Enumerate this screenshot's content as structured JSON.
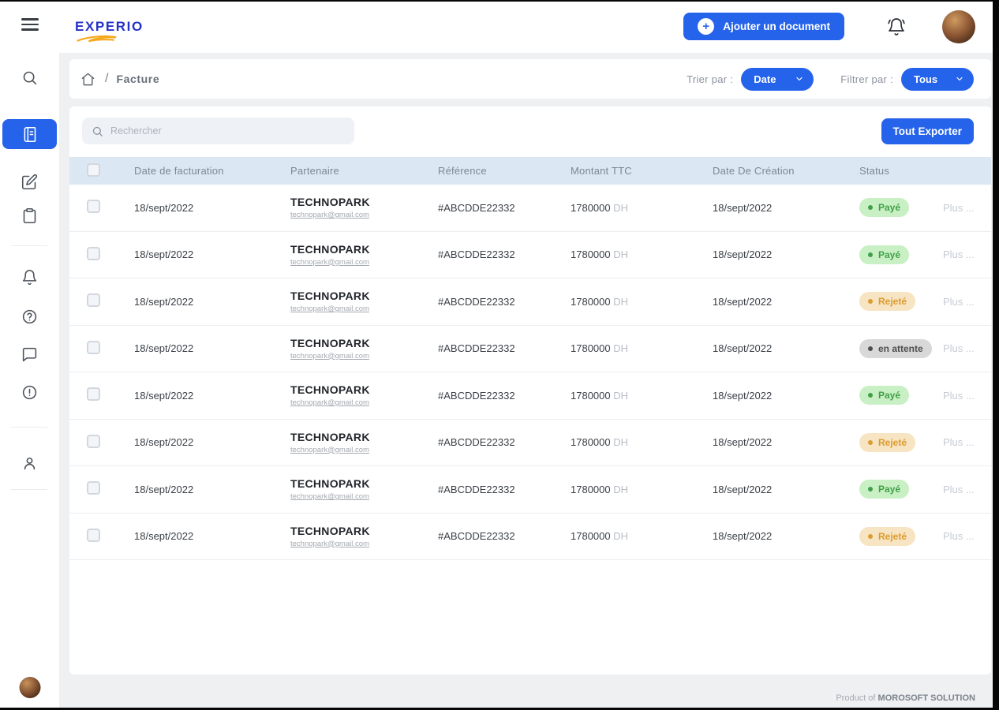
{
  "brand": {
    "name": "EXPERIO"
  },
  "header": {
    "add_document_button": "Ajouter un document"
  },
  "breadcrumb": {
    "separator": "/",
    "current": "Facture"
  },
  "filters": {
    "sort_label": "Trier par :",
    "sort_value": "Date",
    "filter_label": "Filtrer par :",
    "filter_value": "Tous"
  },
  "toolbar": {
    "search_placeholder": "Rechercher",
    "export_button": "Tout Exporter"
  },
  "table": {
    "columns": [
      "Date de facturation",
      "Partenaire",
      "Référence",
      "Montant TTC",
      "Date De Création",
      "Status"
    ],
    "more_label": "Plus ...",
    "rows": [
      {
        "date": "18/sept/2022",
        "partner": "TECHNOPARK",
        "email": "technopark@gmail.com",
        "reference": "#ABCDDE22332",
        "amount": "1780000",
        "currency": "DH",
        "created": "18/sept/2022",
        "status": "Payé",
        "status_type": "paid"
      },
      {
        "date": "18/sept/2022",
        "partner": "TECHNOPARK",
        "email": "technopark@gmail.com",
        "reference": "#ABCDDE22332",
        "amount": "1780000",
        "currency": "DH",
        "created": "18/sept/2022",
        "status": "Payé",
        "status_type": "paid"
      },
      {
        "date": "18/sept/2022",
        "partner": "TECHNOPARK",
        "email": "technopark@gmail.com",
        "reference": "#ABCDDE22332",
        "amount": "1780000",
        "currency": "DH",
        "created": "18/sept/2022",
        "status": "Rejeté",
        "status_type": "rejected"
      },
      {
        "date": "18/sept/2022",
        "partner": "TECHNOPARK",
        "email": "technopark@gmail.com",
        "reference": "#ABCDDE22332",
        "amount": "1780000",
        "currency": "DH",
        "created": "18/sept/2022",
        "status": "en attente",
        "status_type": "pending"
      },
      {
        "date": "18/sept/2022",
        "partner": "TECHNOPARK",
        "email": "technopark@gmail.com",
        "reference": "#ABCDDE22332",
        "amount": "1780000",
        "currency": "DH",
        "created": "18/sept/2022",
        "status": "Payé",
        "status_type": "paid"
      },
      {
        "date": "18/sept/2022",
        "partner": "TECHNOPARK",
        "email": "technopark@gmail.com",
        "reference": "#ABCDDE22332",
        "amount": "1780000",
        "currency": "DH",
        "created": "18/sept/2022",
        "status": "Rejeté",
        "status_type": "rejected"
      },
      {
        "date": "18/sept/2022",
        "partner": "TECHNOPARK",
        "email": "technopark@gmail.com",
        "reference": "#ABCDDE22332",
        "amount": "1780000",
        "currency": "DH",
        "created": "18/sept/2022",
        "status": "Payé",
        "status_type": "paid"
      },
      {
        "date": "18/sept/2022",
        "partner": "TECHNOPARK",
        "email": "technopark@gmail.com",
        "reference": "#ABCDDE22332",
        "amount": "1780000",
        "currency": "DH",
        "created": "18/sept/2022",
        "status": "Rejeté",
        "status_type": "rejected"
      }
    ]
  },
  "footer": {
    "prefix": "Product of ",
    "company": "MOROSOFT SOLUTION"
  },
  "colors": {
    "primary_blue": "#2563eb",
    "logo_blue": "#2431c8",
    "logo_accent_orange": "#f6a81c",
    "table_header_bg": "#dbe7f3",
    "status_paid_bg": "#c9f0c5",
    "status_paid_text": "#41a047",
    "status_rejected_bg": "#f7e4c2",
    "status_rejected_text": "#dc9c2e",
    "status_pending_bg": "#d8d8d8",
    "status_pending_text": "#4e4e4e"
  },
  "icons": {
    "sidebar": [
      "menu-icon",
      "search-icon",
      "book-icon",
      "edit-doc-icon",
      "clipboard-icon",
      "bell-icon",
      "help-icon",
      "chat-icon",
      "alert-icon",
      "user-icon"
    ],
    "header": [
      "plus-circle-icon",
      "bell-ring-icon"
    ],
    "misc": [
      "home-icon",
      "chevron-down-icon",
      "search-icon"
    ]
  }
}
